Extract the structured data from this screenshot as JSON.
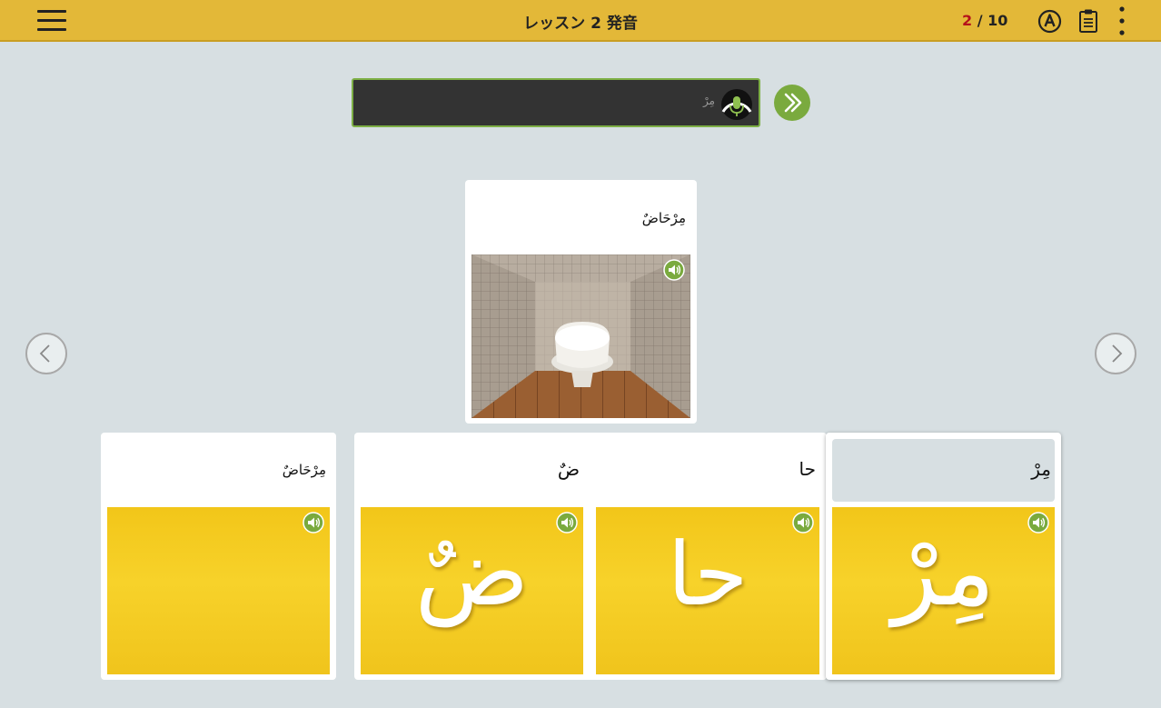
{
  "topbar": {
    "title": "レッスン 2 発音",
    "progress_current": "2",
    "progress_sep": " / ",
    "progress_total": "10"
  },
  "voice": {
    "hint": "مِرْ"
  },
  "main_card": {
    "word": "مِرْحَاضٌ"
  },
  "answers": [
    {
      "label": "مِرْحَاضٌ",
      "glyph": ""
    },
    {
      "label": "ضٌ",
      "glyph": "ضٌ"
    },
    {
      "label": "حا",
      "glyph": "حا"
    },
    {
      "label": "مِرْ",
      "glyph": "مِرْ"
    }
  ],
  "colors": {
    "topbar": "#e3b838",
    "accent_green": "#7aaa3e",
    "progress_current": "#b5121b",
    "card_yellow": "#f4cc22"
  },
  "icons": [
    "menu-icon",
    "autoplay-a-icon",
    "clipboard-icon",
    "more-vertical-icon",
    "microphone-icon",
    "double-chevron-right-icon",
    "speaker-icon",
    "chevron-left-icon",
    "chevron-right-icon"
  ]
}
